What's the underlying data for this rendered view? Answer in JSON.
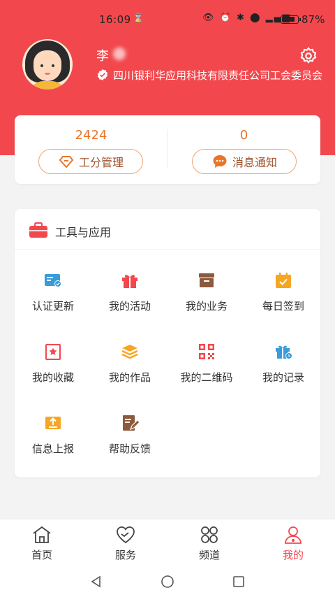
{
  "status": {
    "time": "16:09",
    "battery_pct": "87%",
    "battery_level": 0.87
  },
  "profile": {
    "name": "李",
    "organization": "四川银利华应用科技有限责任公司工会委员会"
  },
  "stats": [
    {
      "value": "2424",
      "button_label": "工分管理",
      "icon": "diamond-icon"
    },
    {
      "value": "0",
      "button_label": "消息通知",
      "icon": "chat-bubble-icon"
    }
  ],
  "tools": {
    "title": "工具与应用",
    "items": [
      {
        "label": "认证更新",
        "icon": "id-card-check-icon"
      },
      {
        "label": "我的活动",
        "icon": "gift-icon"
      },
      {
        "label": "我的业务",
        "icon": "archive-box-icon"
      },
      {
        "label": "每日签到",
        "icon": "calendar-check-icon"
      },
      {
        "label": "我的收藏",
        "icon": "star-frame-icon"
      },
      {
        "label": "我的作品",
        "icon": "layers-icon"
      },
      {
        "label": "我的二维码",
        "icon": "qr-code-icon"
      },
      {
        "label": "我的记录",
        "icon": "gift-box-clock-icon"
      },
      {
        "label": "信息上报",
        "icon": "upload-tray-icon"
      },
      {
        "label": "帮助反馈",
        "icon": "edit-note-icon"
      }
    ]
  },
  "tabs": [
    {
      "label": "首页",
      "icon": "home-icon"
    },
    {
      "label": "服务",
      "icon": "heart-icon"
    },
    {
      "label": "频道",
      "icon": "four-circles-icon"
    },
    {
      "label": "我的",
      "icon": "person-icon",
      "active": true
    }
  ],
  "colors": {
    "brand": "#f2484d",
    "accent": "#e8762a",
    "tool_blue": "#3a9bd9",
    "tool_orange": "#f5a623",
    "tool_brown": "#8b5a3c"
  }
}
